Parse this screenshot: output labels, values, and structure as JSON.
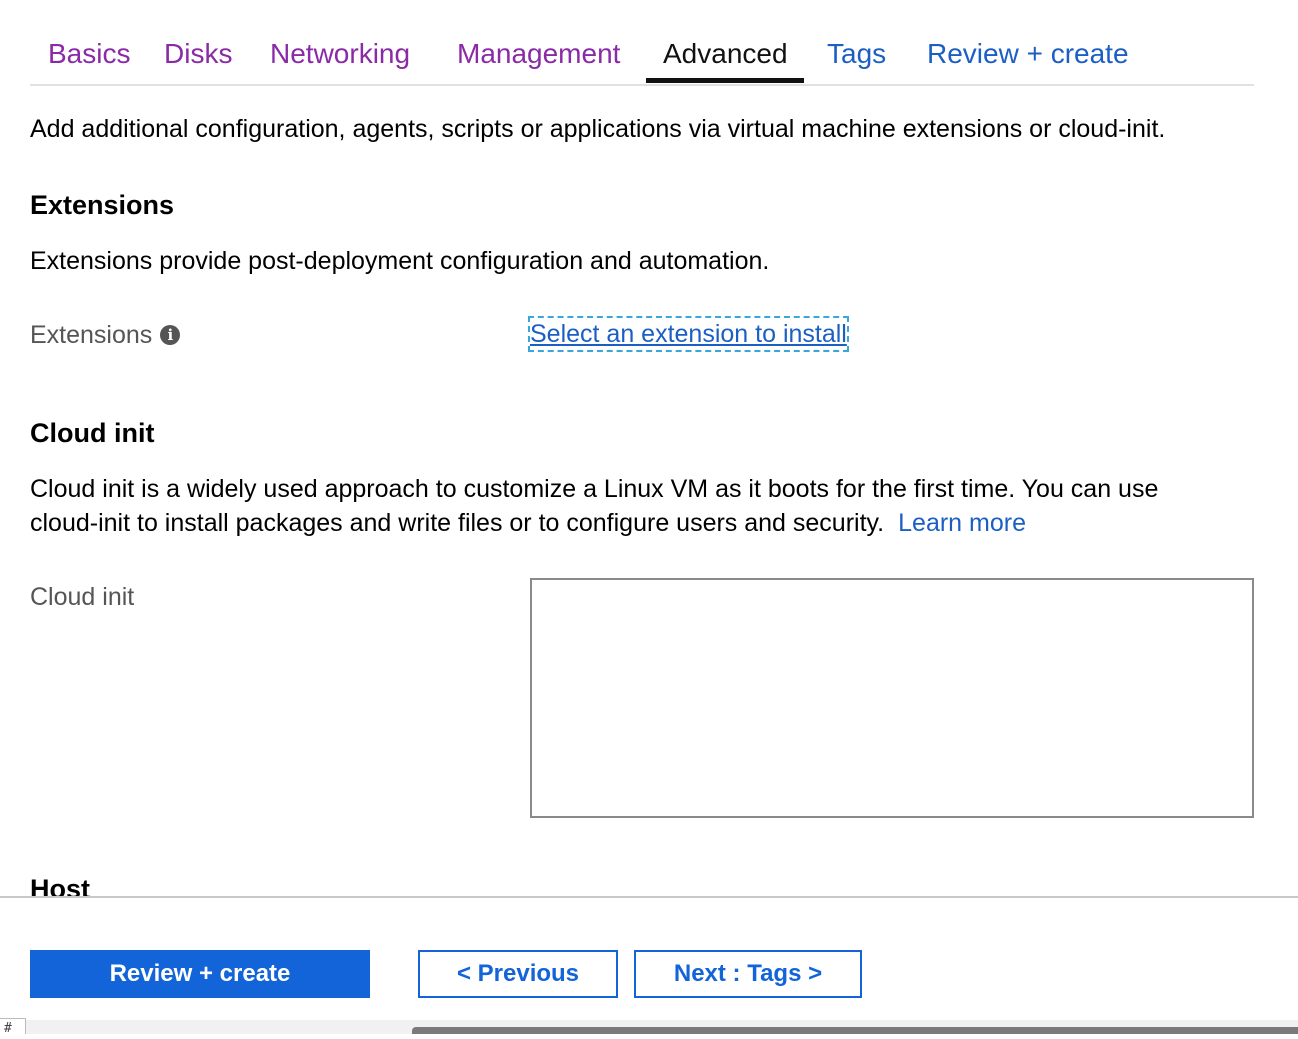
{
  "tabs": [
    {
      "label": "Basics",
      "state": "visited"
    },
    {
      "label": "Disks",
      "state": "visited"
    },
    {
      "label": "Networking",
      "state": "visited"
    },
    {
      "label": "Management",
      "state": "visited"
    },
    {
      "label": "Advanced",
      "state": "active"
    },
    {
      "label": "Tags",
      "state": "link"
    },
    {
      "label": "Review + create",
      "state": "link"
    }
  ],
  "intro": "Add additional configuration, agents, scripts or applications via virtual machine extensions or cloud-init.",
  "extensions": {
    "heading": "Extensions",
    "description": "Extensions provide post-deployment configuration and automation.",
    "field_label": "Extensions",
    "info_icon": "i",
    "link_text": "Select an extension to install"
  },
  "cloud_init": {
    "heading": "Cloud init",
    "description": "Cloud init is a widely used approach to customize a Linux VM as it boots for the first time. You can use cloud-init to install packages and write files or to configure users and security.",
    "learn_more": "Learn more",
    "field_label": "Cloud init",
    "value": ""
  },
  "host": {
    "heading": "Host"
  },
  "footer": {
    "review_create": "Review + create",
    "previous": "< Previous",
    "next": "Next : Tags >"
  },
  "corner_glyph": "#",
  "colors": {
    "visited": "#8a2aa6",
    "link": "#1c5fc4",
    "primary": "#1264d8"
  }
}
